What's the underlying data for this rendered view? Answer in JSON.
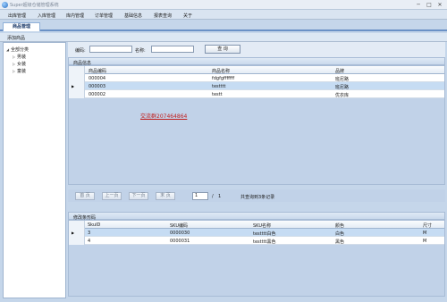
{
  "window": {
    "title": "Super超级仓储管理系统",
    "minimize": "─",
    "maximize": "□",
    "close": "✕"
  },
  "menu": [
    "出库管理",
    "入库管理",
    "库内管理",
    "订单管理",
    "基础信息",
    "报表查询",
    "关于"
  ],
  "tab": {
    "label": "商品管理"
  },
  "toolbar": {
    "add_label": "添加商品"
  },
  "tree": {
    "root": "全部分类",
    "children": [
      "男装",
      "女装",
      "童装"
    ],
    "expanded_icon": "◢",
    "collapsed_icon": "▷"
  },
  "search": {
    "code_label": "编码:",
    "name_label": "名称:",
    "code_value": "",
    "name_value": "",
    "query_label": "查 询"
  },
  "goods": {
    "section_title": "商品信息",
    "columns": [
      "商品编码",
      "商品名称",
      "品牌"
    ],
    "rows": [
      {
        "code": "000004",
        "name": "fdgfgfffffff",
        "brand": "班尼路"
      },
      {
        "code": "000003",
        "name": "testttt",
        "brand": "班尼路"
      },
      {
        "code": "000002",
        "name": "testt",
        "brand": "优衣库"
      }
    ],
    "selected_row": 1,
    "row_pointer": "▶",
    "link_text": "交流群207464864"
  },
  "pager": {
    "first": "首 页",
    "prev": "上一页",
    "next": "下一页",
    "last": "末 页",
    "page": "1",
    "slash": "/",
    "total": "1",
    "info": "共查询到3条记录"
  },
  "sku": {
    "section_title": "修改条形码",
    "columns": [
      "SkuID",
      "SKU编码",
      "SKU名称",
      "颜色",
      "尺寸"
    ],
    "rows": [
      {
        "id": "3",
        "code": "0000030",
        "name": "testttt白色",
        "color": "白色",
        "size": "M"
      },
      {
        "id": "4",
        "code": "0000031",
        "name": "testttt黑色",
        "color": "黑色",
        "size": "M"
      }
    ],
    "selected_row": 0,
    "row_pointer": "▶"
  }
}
